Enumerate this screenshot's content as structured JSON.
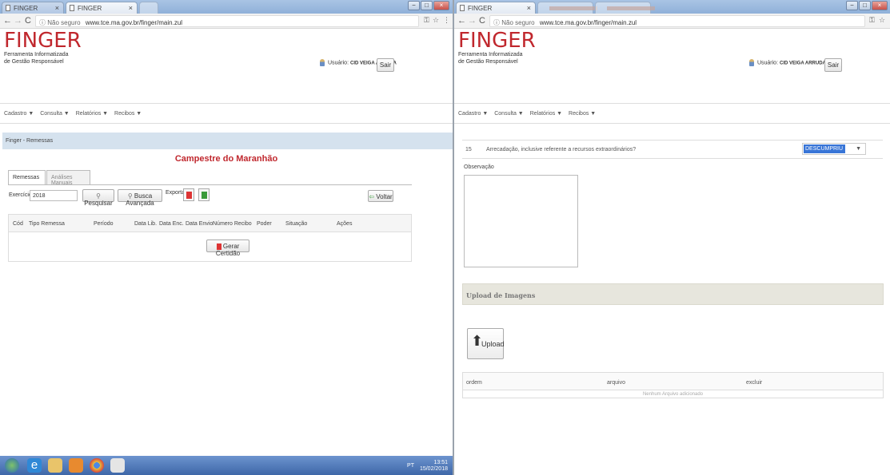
{
  "left": {
    "tabs": [
      "FINGER",
      "FINGER"
    ],
    "address": {
      "security": "ⓘ Não seguro",
      "url": "www.tce.ma.gov.br/finger/main.zul"
    },
    "logo": {
      "title": "FINGER",
      "sub1": "Ferramenta Informatizada",
      "sub2": "de Gestão Responsável"
    },
    "user": {
      "label": "Usuário:",
      "name": "CID VEIGA ARRUDA",
      "logout": "Sair"
    },
    "menu": [
      "Cadastro ▼",
      "Consulta ▼",
      "Relatórios ▼",
      "Recibos ▼"
    ],
    "breadcrumb": "Finger - Remessas",
    "page_title": "Campestre do Maranhão",
    "page_tabs": [
      "Remessas",
      "Análises Manuais"
    ],
    "filter": {
      "label": "Exercício:",
      "year": "2018",
      "search": "Pesquisar",
      "advanced": "Busca Avançada",
      "export": "Exportar:",
      "back": "Voltar"
    },
    "columns": [
      "Cód",
      "Tipo Remessa",
      "Período",
      "Data Lib.",
      "Data Enc.",
      "Data Envio",
      "Número Recibo",
      "Poder",
      "Situação",
      "Ações"
    ],
    "generate": "Gerar Certidão",
    "tray": {
      "lang": "PT",
      "time": "13:51",
      "date": "15/02/2018"
    }
  },
  "right": {
    "tabs": [
      "FINGER"
    ],
    "address": {
      "security": "ⓘ Não seguro",
      "url": "www.tce.ma.gov.br/finger/main.zul"
    },
    "logo": {
      "title": "FINGER",
      "sub1": "Ferramenta Informatizada",
      "sub2": "de Gestão Responsável"
    },
    "user": {
      "label": "Usuário:",
      "name": "CID VEIGA ARRUDA",
      "logout": "Sair"
    },
    "menu": [
      "Cadastro ▼",
      "Consulta ▼",
      "Relatórios ▼",
      "Recibos ▼"
    ],
    "row": {
      "num": "15",
      "text": "Arrecadação, inclusive referente a recursos extraordinários?",
      "value": "DESCUMPRIU"
    },
    "obs_label": "Observação",
    "upload_title": "Upload de Imagens",
    "upload_btn": "Upload",
    "table_cols": [
      "ordem",
      "arquivo",
      "excluir"
    ],
    "table_empty": "Nenhum Arquivo adicionado"
  },
  "colors": {
    "brand_red": "#c0272d",
    "breadcrumb_bg": "#d5e2ee",
    "select_blue": "#3875d7"
  }
}
